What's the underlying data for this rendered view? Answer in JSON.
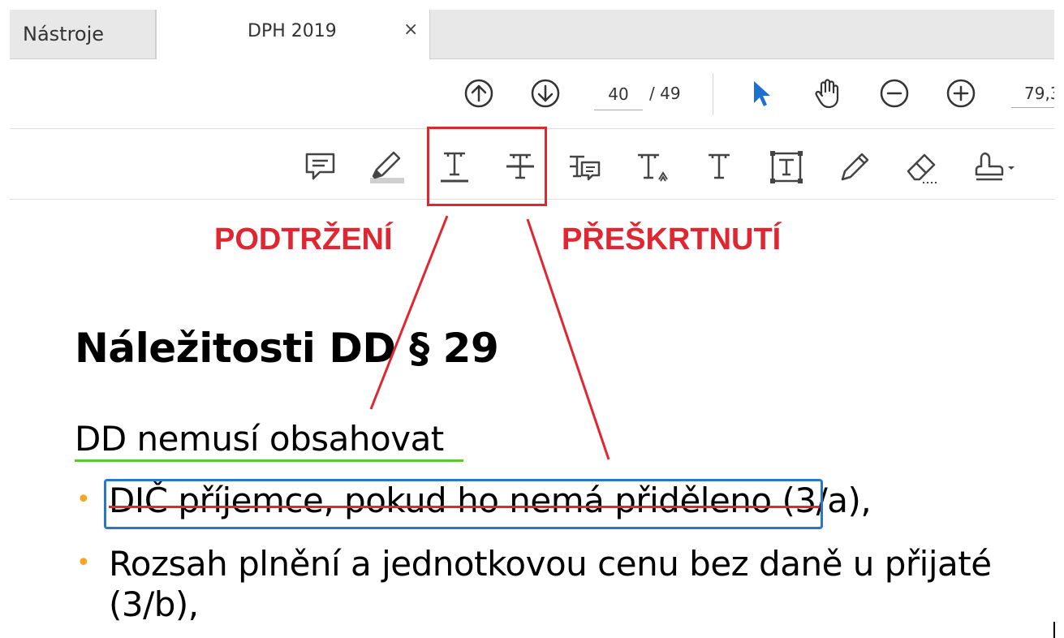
{
  "tabs": {
    "tools_label": "Nástroje",
    "document_label": "DPH 2019",
    "close_glyph": "×"
  },
  "navigation": {
    "current_page": "40",
    "total_pages": "/ 49",
    "zoom": "79,3"
  },
  "icons": {
    "toolbar1": [
      "arrow-up-circle-icon",
      "arrow-down-circle-icon",
      "select-cursor-icon",
      "hand-icon",
      "zoom-out-icon",
      "zoom-in-icon"
    ],
    "toolbar2": [
      "comment-icon",
      "highlight-icon",
      "underline-text-icon",
      "strikethrough-text-icon",
      "replace-text-icon",
      "insert-text-icon",
      "add-text-icon",
      "text-box-icon",
      "pencil-icon",
      "eraser-icon",
      "stamp-icon"
    ]
  },
  "annotations": {
    "underline_label": "PODTRŽENÍ",
    "strikethrough_label": "PŘEŠKRTNUTÍ",
    "accent_color": "#e02630"
  },
  "document": {
    "heading": "Náležitosti DD § 29",
    "subheading": "DD nemusí obsahovat",
    "bullets": [
      {
        "struck": "DIČ příjemce, pokud ho nemá přiděleno",
        "rest": " (3/a),"
      },
      {
        "line1": "Rozsah plnění a jednotkovou cenu bez daně u přijaté",
        "line2": "(3/b),"
      }
    ],
    "bullet_glyph": "•",
    "underline_color": "#5cc531",
    "selection_color": "#2a77c8"
  }
}
